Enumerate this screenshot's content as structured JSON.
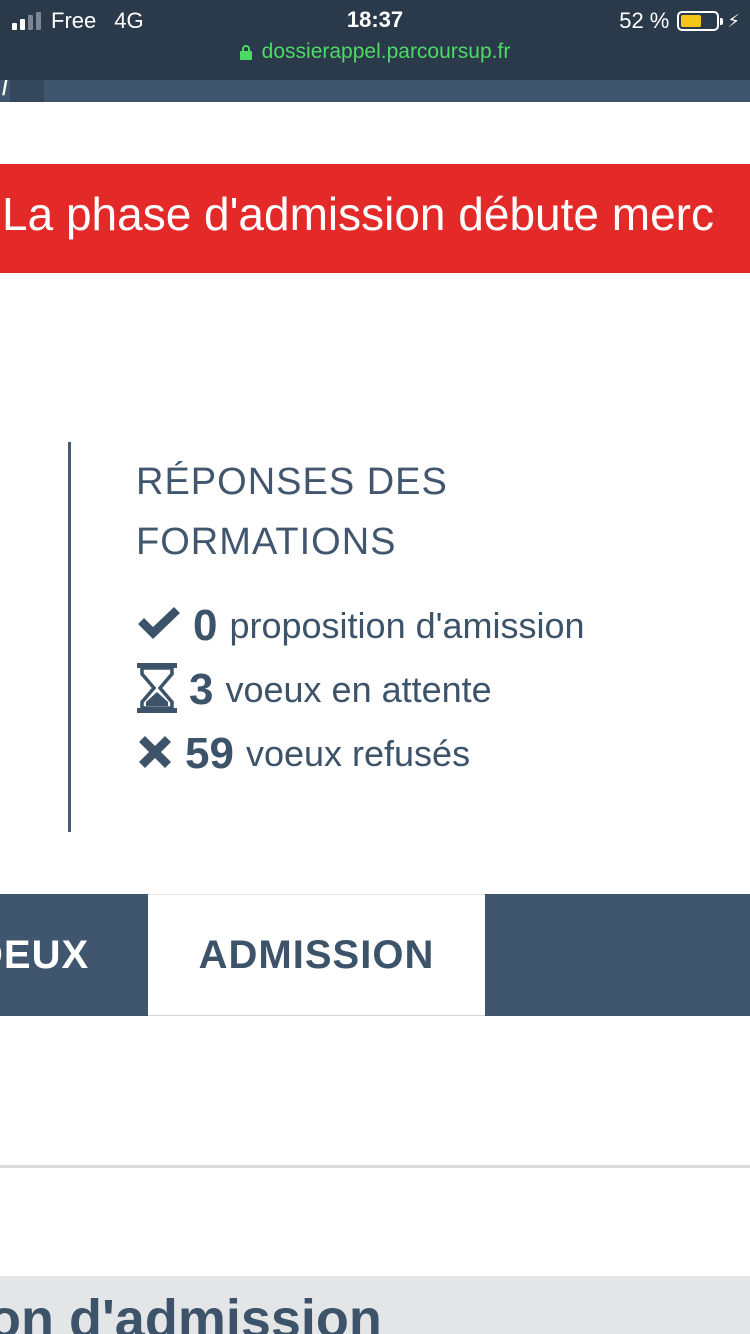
{
  "status_bar": {
    "carrier": "Free",
    "network": "4G",
    "time": "18:37",
    "battery": "52 %",
    "battery_level": 0.52,
    "url": "dossierappel.parcoursup.fr"
  },
  "banner": {
    "text": "La phase d'admission débute merc",
    "color": "#e32a29"
  },
  "responses": {
    "title": "RÉPONSES DES FORMATIONS",
    "items": [
      {
        "icon": "check-icon",
        "count": "0",
        "label": "proposition d'amission"
      },
      {
        "icon": "hourglass-icon",
        "count": "3",
        "label": "voeux en attente"
      },
      {
        "icon": "cross-icon",
        "count": "59",
        "label": "voeux refusés"
      }
    ]
  },
  "tabs": [
    {
      "label": "DEUX",
      "active": false
    },
    {
      "label": "ADMISSION",
      "active": true
    }
  ],
  "bottom": {
    "heading": "on d'admission"
  },
  "colors": {
    "navy": "#40566e",
    "text": "#3d5369",
    "url_green": "#4cd964"
  }
}
